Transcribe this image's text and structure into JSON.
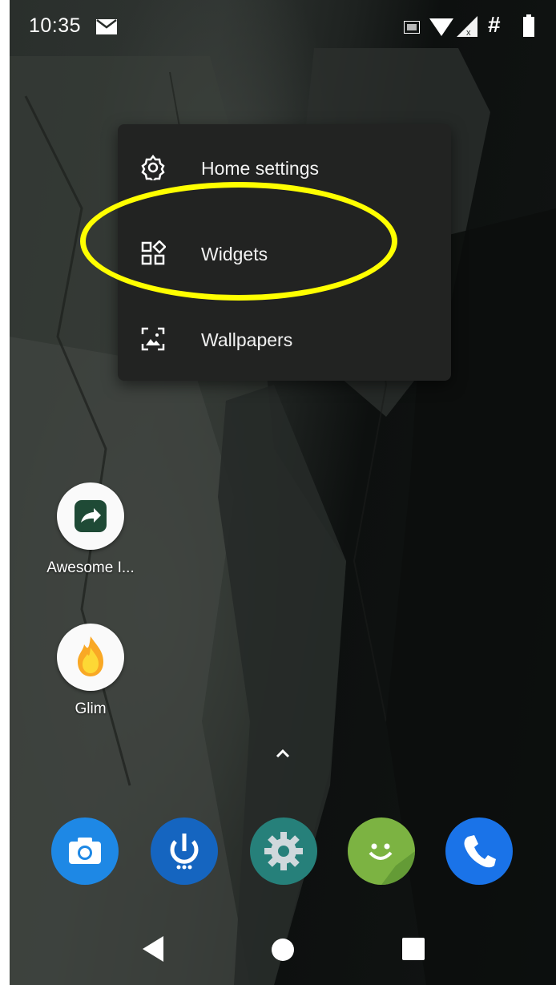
{
  "status_bar": {
    "time": "10:35",
    "icons": [
      "gmail-icon",
      "cast-icon",
      "wifi-icon",
      "signal-icon",
      "hash-icon",
      "battery-icon"
    ],
    "hash_glyph": "#"
  },
  "menu": {
    "items": [
      {
        "label": "Home settings",
        "icon": "gear-icon"
      },
      {
        "label": "Widgets",
        "icon": "widgets-icon"
      },
      {
        "label": "Wallpapers",
        "icon": "wallpaper-icon"
      }
    ],
    "highlight_color": "#ffff00"
  },
  "desktop_apps": [
    {
      "label": "Awesome I...",
      "icon": "share-arrow-icon"
    },
    {
      "label": "Glim",
      "icon": "flame-icon"
    }
  ],
  "dock": {
    "apps": [
      "camera-icon",
      "power-icon",
      "settings-icon",
      "messenger-icon",
      "phone-icon"
    ]
  },
  "nav_bar": {
    "buttons": [
      "back-icon",
      "home-icon",
      "recents-icon"
    ]
  },
  "colors": {
    "camera": "#1e88e5",
    "power": "#1565c0",
    "settings": "#26807a",
    "messenger": "#7cb342",
    "phone": "#1a73e8",
    "menu_bg": "#222322"
  }
}
